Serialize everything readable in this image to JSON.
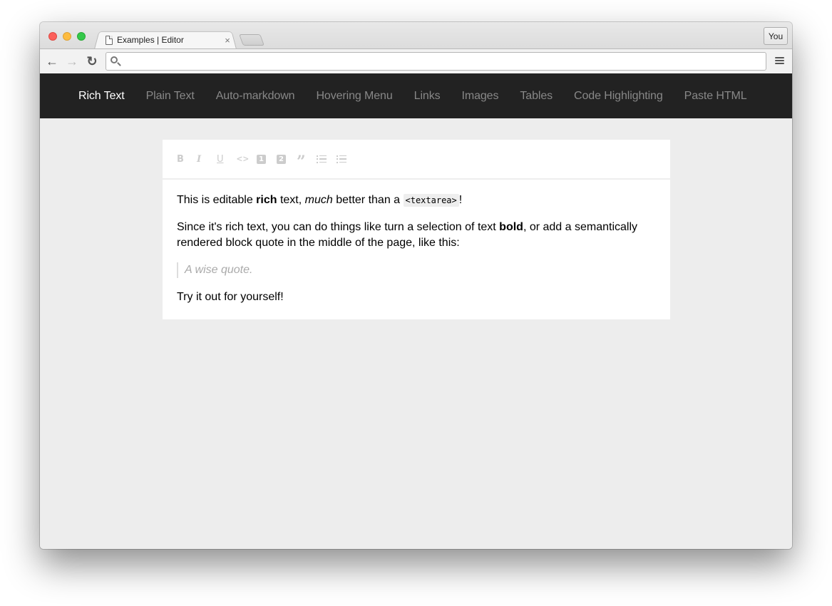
{
  "browser": {
    "tab_title": "Examples | Editor",
    "tab_close_glyph": "×",
    "profile_label": "You",
    "address_value": "",
    "nav": {
      "back_glyph": "←",
      "forward_glyph": "→",
      "reload_glyph": "↻"
    }
  },
  "topnav": {
    "items": [
      {
        "label": "Rich Text",
        "active": true
      },
      {
        "label": "Plain Text",
        "active": false
      },
      {
        "label": "Auto-markdown",
        "active": false
      },
      {
        "label": "Hovering Menu",
        "active": false
      },
      {
        "label": "Links",
        "active": false
      },
      {
        "label": "Images",
        "active": false
      },
      {
        "label": "Tables",
        "active": false
      },
      {
        "label": "Code Highlighting",
        "active": false
      },
      {
        "label": "Paste HTML",
        "active": false
      }
    ],
    "active_color": "#ffffff",
    "inactive_color": "#888888",
    "background": "#222222"
  },
  "editor_toolbar": {
    "buttons": [
      {
        "name": "bold",
        "icon": "format-bold-icon",
        "glyph": "B"
      },
      {
        "name": "italic",
        "icon": "format-italic-icon",
        "glyph": "I"
      },
      {
        "name": "underline",
        "icon": "format-underline-icon",
        "glyph": "U"
      },
      {
        "name": "code",
        "icon": "code-icon",
        "glyph": "<>"
      },
      {
        "name": "heading-one",
        "icon": "heading-one-icon",
        "glyph": "1"
      },
      {
        "name": "heading-two",
        "icon": "heading-two-icon",
        "glyph": "2"
      },
      {
        "name": "block-quote",
        "icon": "quote-icon",
        "glyph": "”"
      },
      {
        "name": "numbered-list",
        "icon": "numbered-list-icon",
        "glyph": ""
      },
      {
        "name": "bulleted-list",
        "icon": "bulleted-list-icon",
        "glyph": ""
      }
    ],
    "icon_color": "#cccccc"
  },
  "document": {
    "p1": {
      "t1": "This is editable ",
      "bold": "rich",
      "t2": " text, ",
      "italic": "much",
      "t3": " better than a ",
      "code": "<textarea>",
      "t4": "!"
    },
    "p2": {
      "t1": "Since it's rich text, you can do things like turn a selection of text ",
      "bold": "bold",
      "t2": ", or add a semantically rendered block quote in the middle of the page, like this:"
    },
    "quote": "A wise quote.",
    "p3": "Try it out for yourself!"
  }
}
